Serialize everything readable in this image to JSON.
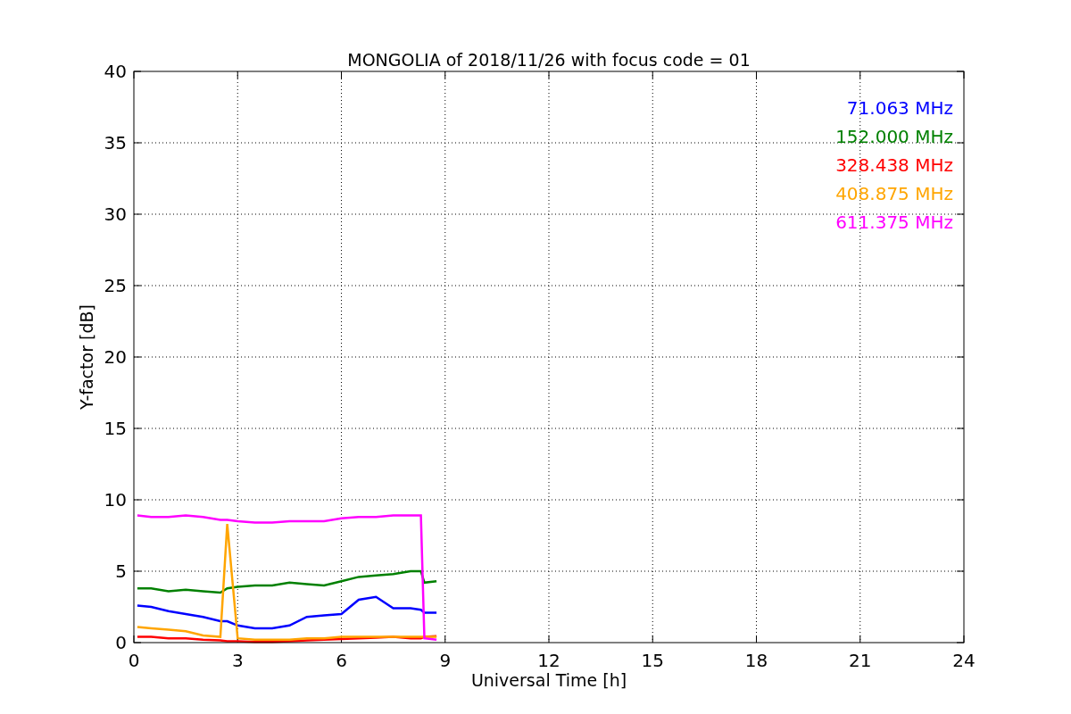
{
  "figure": {
    "chart_data": {
      "type": "line",
      "title": "MONGOLIA of 2018/11/26 with focus code = 01",
      "xlabel": "Universal Time [h]",
      "ylabel": "Y-factor [dB]",
      "x": [
        0.1,
        0.5,
        1,
        1.5,
        2,
        2.5,
        2.7,
        3,
        3.5,
        4,
        4.5,
        5,
        5.5,
        6,
        6.5,
        7,
        7.5,
        8,
        8.3,
        8.4,
        8.75
      ],
      "series": [
        {
          "name": "71.063 MHz",
          "color": "#0000ff",
          "values": [
            2.6,
            2.5,
            2.2,
            2.0,
            1.8,
            1.5,
            1.5,
            1.2,
            1.0,
            1.0,
            1.2,
            1.8,
            1.9,
            2.0,
            3.0,
            3.2,
            2.4,
            2.4,
            2.3,
            2.1,
            2.1
          ]
        },
        {
          "name": "152.000 MHz",
          "color": "#008000",
          "values": [
            3.8,
            3.8,
            3.6,
            3.7,
            3.6,
            3.5,
            3.8,
            3.9,
            4.0,
            4.0,
            4.2,
            4.1,
            4.0,
            4.3,
            4.6,
            4.7,
            4.8,
            5.0,
            5.0,
            4.2,
            4.3
          ]
        },
        {
          "name": "328.438 MHz",
          "color": "#ff0000",
          "values": [
            0.4,
            0.4,
            0.3,
            0.3,
            0.2,
            0.15,
            0.1,
            0.1,
            0.05,
            0.05,
            0.1,
            0.15,
            0.2,
            0.25,
            0.3,
            0.35,
            0.4,
            0.3,
            0.3,
            0.4,
            0.45
          ]
        },
        {
          "name": "408.875 MHz",
          "color": "#ffa500",
          "values": [
            1.1,
            1.0,
            0.9,
            0.8,
            0.5,
            0.4,
            8.3,
            0.3,
            0.2,
            0.2,
            0.2,
            0.3,
            0.3,
            0.4,
            0.4,
            0.4,
            0.4,
            0.4,
            0.4,
            0.4,
            0.4
          ]
        },
        {
          "name": "611.375 MHz",
          "color": "#ff00ff",
          "values": [
            8.9,
            8.8,
            8.8,
            8.9,
            8.8,
            8.6,
            8.6,
            8.5,
            8.4,
            8.4,
            8.5,
            8.5,
            8.5,
            8.7,
            8.8,
            8.8,
            8.9,
            8.9,
            8.9,
            0.3,
            0.2
          ]
        }
      ],
      "grid": true,
      "xlim": [
        0,
        24
      ],
      "ylim": [
        0,
        40
      ],
      "xticks": [
        0,
        3,
        6,
        9,
        12,
        15,
        18,
        21,
        24
      ],
      "yticks": [
        0,
        5,
        10,
        15,
        20,
        25,
        30,
        35,
        40
      ]
    }
  }
}
